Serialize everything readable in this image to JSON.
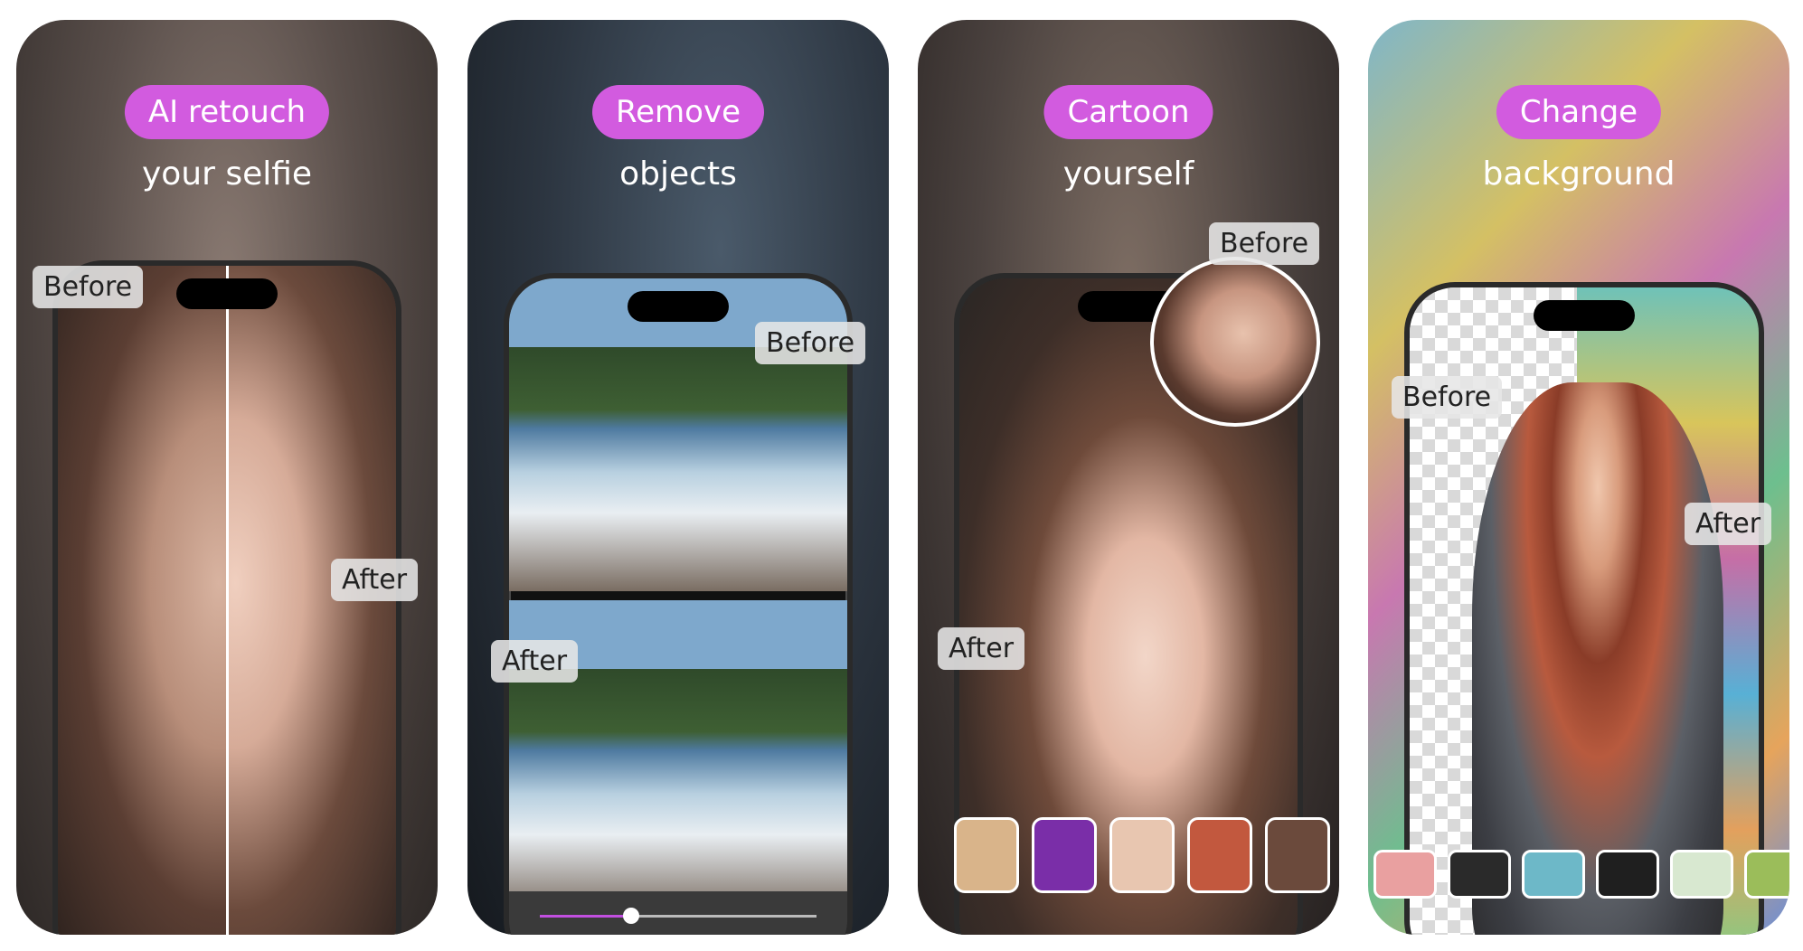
{
  "cards": [
    {
      "pill": "AI retouch",
      "subline": "your selfie",
      "before_label": "Before",
      "after_label": "After"
    },
    {
      "pill": "Remove",
      "subline": "objects",
      "before_label": "Before",
      "after_label": "After",
      "slider_value": 0.33
    },
    {
      "pill": "Cartoon",
      "subline": "yourself",
      "before_label": "Before",
      "after_label": "After",
      "style_thumbs": [
        "#d9b48a",
        "#7a2ea8",
        "#e8c6b0",
        "#c2583e",
        "#6b4a3c"
      ]
    },
    {
      "pill": "Change",
      "subline": "background",
      "before_label": "Before",
      "after_label": "After",
      "background_swatches": [
        "#e9a0a0",
        "#2a2a2a",
        "#6db8c8",
        "#1f1f1f",
        "#d8e8d0",
        "#9bbd5a"
      ]
    }
  ],
  "accent_color": "#d25bdf"
}
